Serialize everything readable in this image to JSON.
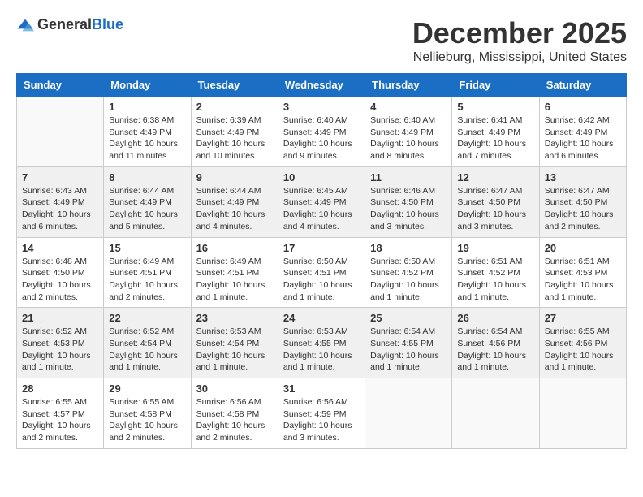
{
  "header": {
    "logo_general": "General",
    "logo_blue": "Blue",
    "month": "December 2025",
    "location": "Nellieburg, Mississippi, United States"
  },
  "days_of_week": [
    "Sunday",
    "Monday",
    "Tuesday",
    "Wednesday",
    "Thursday",
    "Friday",
    "Saturday"
  ],
  "weeks": [
    [
      {
        "day": "",
        "info": ""
      },
      {
        "day": "1",
        "info": "Sunrise: 6:38 AM\nSunset: 4:49 PM\nDaylight: 10 hours\nand 11 minutes."
      },
      {
        "day": "2",
        "info": "Sunrise: 6:39 AM\nSunset: 4:49 PM\nDaylight: 10 hours\nand 10 minutes."
      },
      {
        "day": "3",
        "info": "Sunrise: 6:40 AM\nSunset: 4:49 PM\nDaylight: 10 hours\nand 9 minutes."
      },
      {
        "day": "4",
        "info": "Sunrise: 6:40 AM\nSunset: 4:49 PM\nDaylight: 10 hours\nand 8 minutes."
      },
      {
        "day": "5",
        "info": "Sunrise: 6:41 AM\nSunset: 4:49 PM\nDaylight: 10 hours\nand 7 minutes."
      },
      {
        "day": "6",
        "info": "Sunrise: 6:42 AM\nSunset: 4:49 PM\nDaylight: 10 hours\nand 6 minutes."
      }
    ],
    [
      {
        "day": "7",
        "info": "Sunrise: 6:43 AM\nSunset: 4:49 PM\nDaylight: 10 hours\nand 6 minutes."
      },
      {
        "day": "8",
        "info": "Sunrise: 6:44 AM\nSunset: 4:49 PM\nDaylight: 10 hours\nand 5 minutes."
      },
      {
        "day": "9",
        "info": "Sunrise: 6:44 AM\nSunset: 4:49 PM\nDaylight: 10 hours\nand 4 minutes."
      },
      {
        "day": "10",
        "info": "Sunrise: 6:45 AM\nSunset: 4:49 PM\nDaylight: 10 hours\nand 4 minutes."
      },
      {
        "day": "11",
        "info": "Sunrise: 6:46 AM\nSunset: 4:50 PM\nDaylight: 10 hours\nand 3 minutes."
      },
      {
        "day": "12",
        "info": "Sunrise: 6:47 AM\nSunset: 4:50 PM\nDaylight: 10 hours\nand 3 minutes."
      },
      {
        "day": "13",
        "info": "Sunrise: 6:47 AM\nSunset: 4:50 PM\nDaylight: 10 hours\nand 2 minutes."
      }
    ],
    [
      {
        "day": "14",
        "info": "Sunrise: 6:48 AM\nSunset: 4:50 PM\nDaylight: 10 hours\nand 2 minutes."
      },
      {
        "day": "15",
        "info": "Sunrise: 6:49 AM\nSunset: 4:51 PM\nDaylight: 10 hours\nand 2 minutes."
      },
      {
        "day": "16",
        "info": "Sunrise: 6:49 AM\nSunset: 4:51 PM\nDaylight: 10 hours\nand 1 minute."
      },
      {
        "day": "17",
        "info": "Sunrise: 6:50 AM\nSunset: 4:51 PM\nDaylight: 10 hours\nand 1 minute."
      },
      {
        "day": "18",
        "info": "Sunrise: 6:50 AM\nSunset: 4:52 PM\nDaylight: 10 hours\nand 1 minute."
      },
      {
        "day": "19",
        "info": "Sunrise: 6:51 AM\nSunset: 4:52 PM\nDaylight: 10 hours\nand 1 minute."
      },
      {
        "day": "20",
        "info": "Sunrise: 6:51 AM\nSunset: 4:53 PM\nDaylight: 10 hours\nand 1 minute."
      }
    ],
    [
      {
        "day": "21",
        "info": "Sunrise: 6:52 AM\nSunset: 4:53 PM\nDaylight: 10 hours\nand 1 minute."
      },
      {
        "day": "22",
        "info": "Sunrise: 6:52 AM\nSunset: 4:54 PM\nDaylight: 10 hours\nand 1 minute."
      },
      {
        "day": "23",
        "info": "Sunrise: 6:53 AM\nSunset: 4:54 PM\nDaylight: 10 hours\nand 1 minute."
      },
      {
        "day": "24",
        "info": "Sunrise: 6:53 AM\nSunset: 4:55 PM\nDaylight: 10 hours\nand 1 minute."
      },
      {
        "day": "25",
        "info": "Sunrise: 6:54 AM\nSunset: 4:55 PM\nDaylight: 10 hours\nand 1 minute."
      },
      {
        "day": "26",
        "info": "Sunrise: 6:54 AM\nSunset: 4:56 PM\nDaylight: 10 hours\nand 1 minute."
      },
      {
        "day": "27",
        "info": "Sunrise: 6:55 AM\nSunset: 4:56 PM\nDaylight: 10 hours\nand 1 minute."
      }
    ],
    [
      {
        "day": "28",
        "info": "Sunrise: 6:55 AM\nSunset: 4:57 PM\nDaylight: 10 hours\nand 2 minutes."
      },
      {
        "day": "29",
        "info": "Sunrise: 6:55 AM\nSunset: 4:58 PM\nDaylight: 10 hours\nand 2 minutes."
      },
      {
        "day": "30",
        "info": "Sunrise: 6:56 AM\nSunset: 4:58 PM\nDaylight: 10 hours\nand 2 minutes."
      },
      {
        "day": "31",
        "info": "Sunrise: 6:56 AM\nSunset: 4:59 PM\nDaylight: 10 hours\nand 3 minutes."
      },
      {
        "day": "",
        "info": ""
      },
      {
        "day": "",
        "info": ""
      },
      {
        "day": "",
        "info": ""
      }
    ]
  ]
}
